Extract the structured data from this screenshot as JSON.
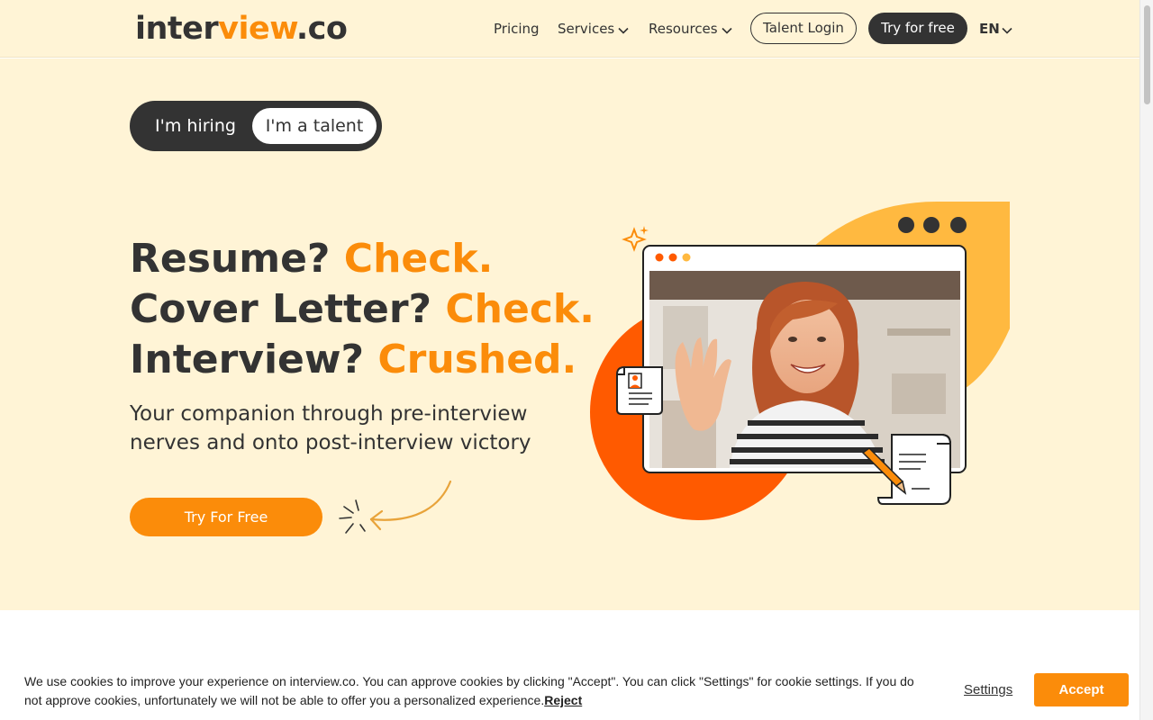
{
  "header": {
    "logo": {
      "part1": "inter",
      "part2": "view",
      "part3": ".co"
    },
    "nav": {
      "pricing": "Pricing",
      "services": "Services",
      "resources": "Resources"
    },
    "talent_login": "Talent Login",
    "try_free": "Try for free",
    "language": "EN"
  },
  "hero": {
    "toggle": {
      "hiring": "I'm hiring",
      "talent": "I'm a talent",
      "selected": "I'm a talent"
    },
    "headline": [
      {
        "text": "Resume? ",
        "highlight": "Check."
      },
      {
        "text": "Cover Letter? ",
        "highlight": "Check."
      },
      {
        "text": "Interview? ",
        "highlight": "Crushed."
      }
    ],
    "subtitle": "Your companion through pre-interview nerves and onto post-interview victory",
    "cta": "Try For Free"
  },
  "cookie": {
    "text": "We use cookies to improve your experience on interview.co. You can approve cookies by clicking \"Accept\". You can click \"Settings\" for cookie settings. If you do not approve cookies, unfortunately we will not be able to offer you a personalized experience.",
    "reject": "Reject",
    "settings": "Settings",
    "accept": "Accept"
  },
  "colors": {
    "accent": "#fb8c0a",
    "dark": "#333333",
    "hero_bg": "#fff4d6",
    "orange_red": "#ff5a00",
    "yellow": "#ffb940"
  },
  "icons": [
    "chevron-down-icon",
    "sparkle-icon",
    "arrow-doodle-icon",
    "resume-document-icon",
    "pen-icon"
  ]
}
